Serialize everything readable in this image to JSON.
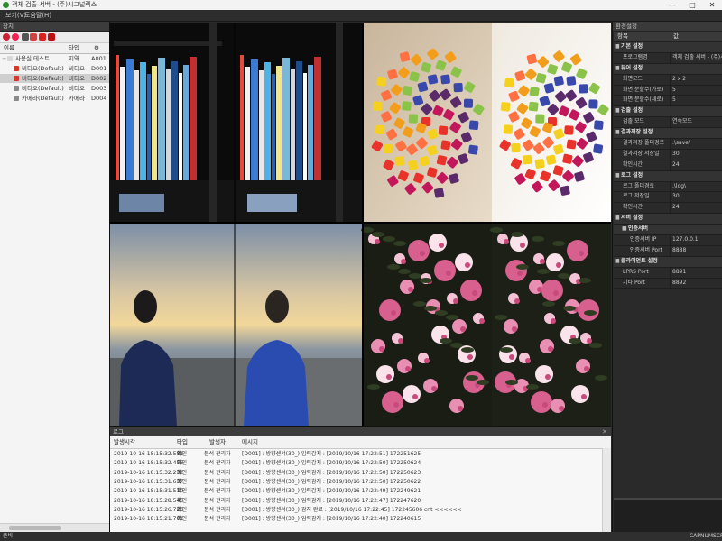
{
  "window": {
    "title": "객체 검출 서버 - (주)시그널렉스",
    "minimize_glyph": "—",
    "maximize_glyph": "□",
    "close_glyph": "✕"
  },
  "menu": {
    "items": [
      "보기(V)",
      "도움말(H)"
    ]
  },
  "left_panel": {
    "title": "장치",
    "columns": [
      "이름",
      "타입",
      "ID"
    ],
    "settings_icon": "gear-icon",
    "toolbar_icons": [
      "device-add-icon",
      "device-remove-icon",
      "camera-icon",
      "camera-add-icon",
      "record-icon",
      "stop-icon"
    ],
    "tree": [
      {
        "name": "사용실 테스트",
        "type": "지역",
        "id": "A001",
        "icon": "folder-icon",
        "color": "#d8d8d8",
        "indent": 0,
        "selected": false
      },
      {
        "name": "비디오(Default)",
        "type": "비디오",
        "id": "D001",
        "icon": "video-icon",
        "color": "#d33a2c",
        "indent": 1,
        "selected": false
      },
      {
        "name": "비디오(Default)",
        "type": "비디오",
        "id": "D002",
        "icon": "video-icon",
        "color": "#d33a2c",
        "indent": 1,
        "selected": true
      },
      {
        "name": "비디오(Default)",
        "type": "비디오",
        "id": "D003",
        "icon": "video-icon",
        "color": "#8a8a8a",
        "indent": 1,
        "selected": false
      },
      {
        "name": "카메라(Default)",
        "type": "카메라",
        "id": "D004",
        "icon": "camera-icon",
        "color": "#8a8a8a",
        "indent": 1,
        "selected": false
      }
    ]
  },
  "right_panel": {
    "title": "환경설정",
    "columns": [
      "항목",
      "값"
    ],
    "rows": [
      {
        "kind": "cat",
        "label": "기본 설정"
      },
      {
        "kind": "item",
        "label": "프로그램명",
        "value": "객체 검출 서버 - (주)시..."
      },
      {
        "kind": "cat",
        "label": "뷰어 설정"
      },
      {
        "kind": "item",
        "label": "화면모드",
        "value": "2 x 2"
      },
      {
        "kind": "item",
        "label": "화면 분할수(가로)",
        "value": "5"
      },
      {
        "kind": "item",
        "label": "화면 분할수(세로)",
        "value": "5"
      },
      {
        "kind": "cat",
        "label": "검출 설정"
      },
      {
        "kind": "item",
        "label": "검출 모드",
        "value": "연속모드"
      },
      {
        "kind": "cat",
        "label": "결과저장 설정"
      },
      {
        "kind": "item",
        "label": "결과저장 폴더경로",
        "value": ".\\save\\"
      },
      {
        "kind": "item",
        "label": "결과저장 저장일",
        "value": "30"
      },
      {
        "kind": "item",
        "label": "확인시간",
        "value": "24"
      },
      {
        "kind": "cat",
        "label": "로그 설정"
      },
      {
        "kind": "item",
        "label": "로그 폴더경로",
        "value": ".\\log\\"
      },
      {
        "kind": "item",
        "label": "로그 저장일",
        "value": "30"
      },
      {
        "kind": "item",
        "label": "확인시간",
        "value": "24"
      },
      {
        "kind": "cat",
        "label": "서버 설정"
      },
      {
        "kind": "cat",
        "label": "인증서버",
        "sub": true
      },
      {
        "kind": "item",
        "label": "인증서버 IP",
        "value": "127.0.0.1",
        "sub": true
      },
      {
        "kind": "item",
        "label": "인증서버 Port",
        "value": "8888",
        "sub": true
      },
      {
        "kind": "cat",
        "label": "클라이언트 설정"
      },
      {
        "kind": "item",
        "label": "LPRS Port",
        "value": "8891"
      },
      {
        "kind": "item",
        "label": "기타 Port",
        "value": "8892"
      }
    ]
  },
  "video_grid": {
    "mode": "2 x 2",
    "cells": [
      "bookshelf",
      "bookshelf",
      "candy",
      "candy",
      "beach-person",
      "beach-person",
      "flowers",
      "flowers"
    ]
  },
  "log_panel": {
    "title": "로그",
    "columns": [
      "발생시각",
      "타입",
      "발생자",
      "메시지"
    ],
    "rows": [
      {
        "time": "2019-10-16 18:15:32.581",
        "type": "확인",
        "actor": "분석 관리자",
        "msg": "[D001] : 방향센서(30_) 입력감지 : [2019/10/16 17:22:51] 172251625"
      },
      {
        "time": "2019-10-16 18:15:32.455",
        "type": "확인",
        "actor": "분석 관리자",
        "msg": "[D001] : 방향센서(30_) 입력감지 : [2019/10/16 17:22:50] 172250624"
      },
      {
        "time": "2019-10-16 18:15:32.232",
        "type": "확인",
        "actor": "분석 관리자",
        "msg": "[D001] : 방향센서(30_) 입력감지 : [2019/10/16 17:22:50] 172250623"
      },
      {
        "time": "2019-10-16 18:15:31.637",
        "type": "확인",
        "actor": "분석 관리자",
        "msg": "[D001] : 방향센서(30_) 입력감지 : [2019/10/16 17:22:50] 172250622"
      },
      {
        "time": "2019-10-16 18:15:31.510",
        "type": "확인",
        "actor": "분석 관리자",
        "msg": "[D001] : 방향센서(30_) 입력감지 : [2019/10/16 17:22:49] 172249621"
      },
      {
        "time": "2019-10-16 18:15:28.545",
        "type": "확인",
        "actor": "분석 관리자",
        "msg": "[D001] : 방향센서(30_) 입력감지 : [2019/10/16 17:22:47] 172247620"
      },
      {
        "time": "2019-10-16 18:15:26.728",
        "type": "확인",
        "actor": "분석 관리자",
        "msg": "[D001] : 방향센서(30_) 감지 완료 : [2019/10/16 17:22:45] 172245606   cnt <<<<<<"
      },
      {
        "time": "2019-10-16 18:15:21.701",
        "type": "확인",
        "actor": "분석 관리자",
        "msg": "[D001] : 방향센서(30_) 입력감지 : [2019/10/16 17:22:40] 172240615"
      }
    ]
  },
  "status_bar": {
    "left": "준비",
    "indicators": [
      "CAP",
      "NUM",
      "SCRL"
    ]
  }
}
